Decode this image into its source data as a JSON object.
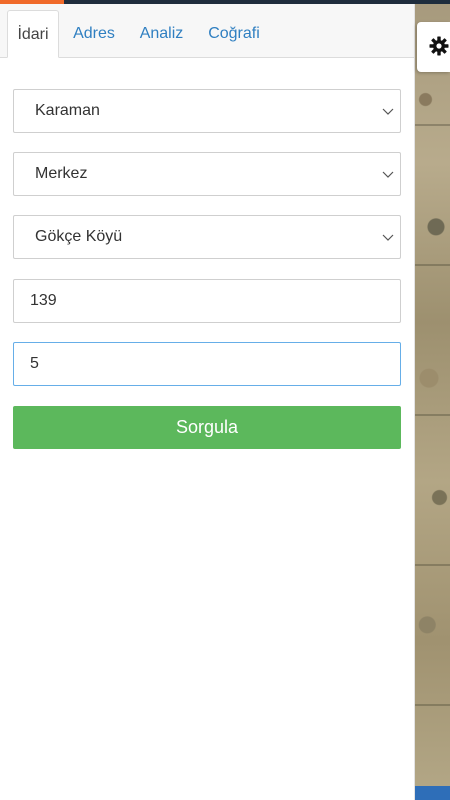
{
  "tabs": [
    {
      "label": "İdari",
      "active": true
    },
    {
      "label": "Adres"
    },
    {
      "label": "Analiz"
    },
    {
      "label": "Coğrafi"
    }
  ],
  "form": {
    "il": {
      "value": "Karaman"
    },
    "ilce": {
      "value": "Merkez"
    },
    "mahalle": {
      "value": "Gökçe Köyü"
    },
    "ada": {
      "value": "139"
    },
    "parsel": {
      "value": "5"
    },
    "submit_label": "Sorgula"
  },
  "map": {
    "settings_icon": "gear-icon"
  },
  "colors": {
    "tab_link": "#2f7fc1",
    "submit": "#5cb85c",
    "focus_border": "#66aee8",
    "top_accent": "#f06a2a",
    "top_bar": "#1f2d3d"
  }
}
